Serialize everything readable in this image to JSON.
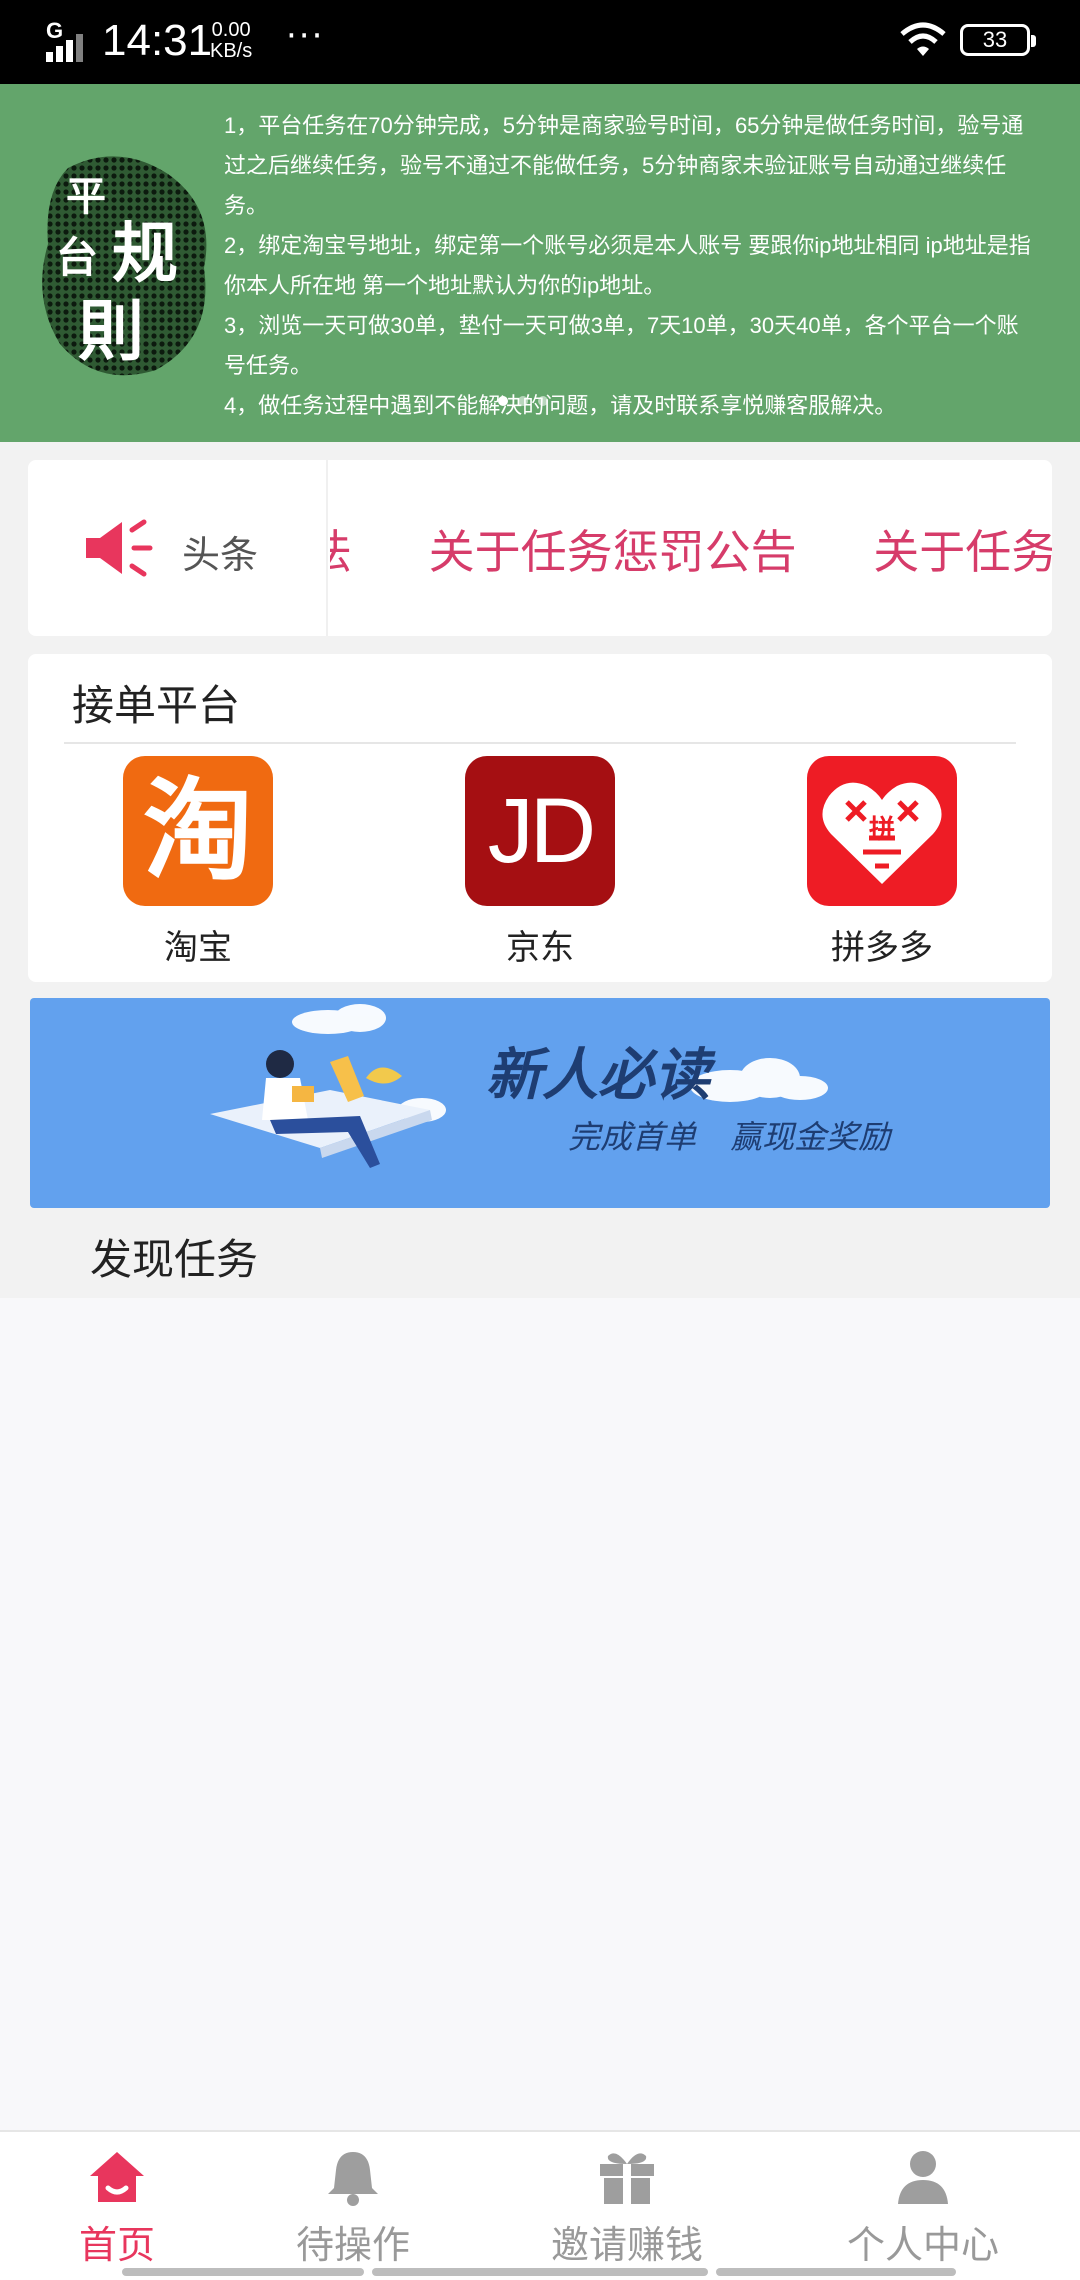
{
  "status_bar": {
    "network": "G",
    "time": "14:31",
    "speed_value": "0.00",
    "speed_unit": "KB/s",
    "more": "···",
    "battery": "33"
  },
  "rules_banner": {
    "logo_text": [
      "平",
      "台",
      "规",
      "則"
    ],
    "items": [
      "1，平台任务在70分钟完成，5分钟是商家验号时间，65分钟是做任务时间，验号通过之后继续任务，验号不通过不能做任务，5分钟商家未验证账号自动通过继续任务。",
      "2，绑定淘宝号地址，绑定第一个账号必须是本人账号 要跟你ip地址相同 ip地址是指你本人所在地 第一个地址默认为你的ip地址。",
      "3，浏览一天可做30单，垫付一天可做3单，7天10单，30天40单，各个平台一个账号任务。",
      "4，做任务过程中遇到不能解决的问题，请及时联系享悦赚客服解决。"
    ]
  },
  "notice": {
    "label": "头条",
    "items": [
      "法",
      "关于任务惩罚公告",
      "关于任务"
    ]
  },
  "platforms": {
    "title": "接单平台",
    "items": [
      {
        "name": "淘宝",
        "glyph": "淘"
      },
      {
        "name": "京东",
        "glyph": "JD"
      },
      {
        "name": "拼多多",
        "glyph": "拼"
      }
    ]
  },
  "newbie_banner": {
    "title": "新人必读",
    "subtitle": "完成首单 赢现金奖励"
  },
  "discover": {
    "title": "发现任务"
  },
  "tabbar": {
    "items": [
      {
        "label": "首页",
        "icon": "home-icon",
        "active": true
      },
      {
        "label": "待操作",
        "icon": "bell-icon",
        "active": false
      },
      {
        "label": "邀请赚钱",
        "icon": "gift-icon",
        "active": false
      },
      {
        "label": "个人中心",
        "icon": "person-icon",
        "active": false
      }
    ]
  },
  "colors": {
    "accent": "#e8365d",
    "banner_green": "#63a56b",
    "headline_text": "#d63c6a",
    "newbie_blue": "#62a1ee"
  }
}
